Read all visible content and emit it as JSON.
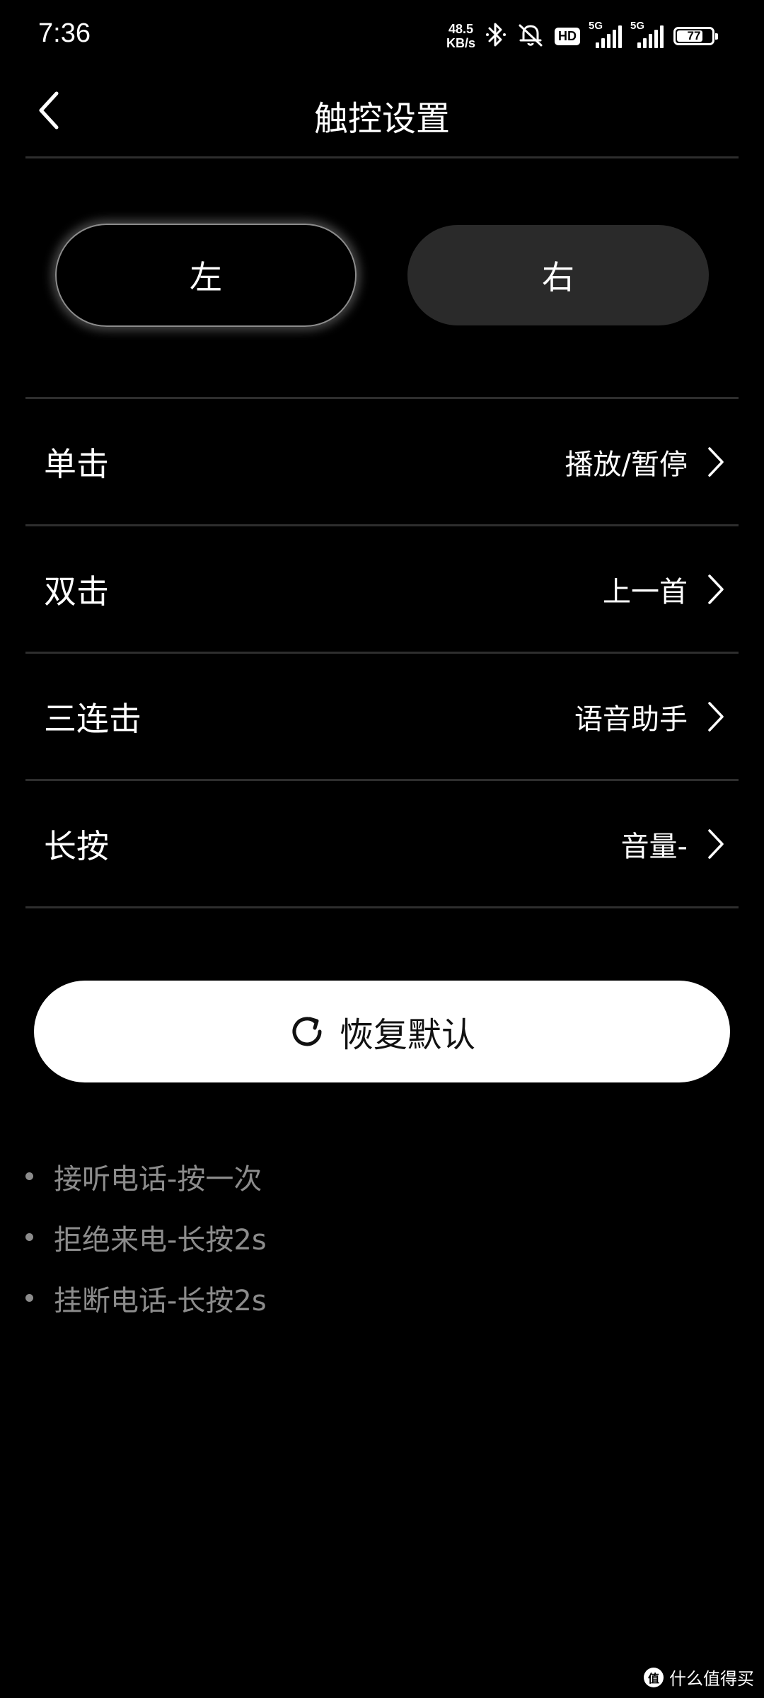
{
  "status_bar": {
    "time": "7:36",
    "net_speed_value": "48.5",
    "net_speed_unit": "KB/s",
    "hd_label": "HD",
    "signal_1_label": "5G",
    "signal_2_label": "5G",
    "battery_percent": "77",
    "battery_level": 0.77,
    "icons": [
      "bluetooth-icon",
      "mute-bell-icon"
    ]
  },
  "header": {
    "title": "触控设置",
    "back_icon": "chevron-left-icon"
  },
  "side_toggle": {
    "left_label": "左",
    "right_label": "右",
    "selected": "left"
  },
  "gestures": [
    {
      "label": "单击",
      "value": "播放/暂停"
    },
    {
      "label": "双击",
      "value": "上一首"
    },
    {
      "label": "三连击",
      "value": "语音助手"
    },
    {
      "label": "长按",
      "value": "音量-"
    }
  ],
  "reset": {
    "label": "恢复默认",
    "icon": "refresh-icon"
  },
  "notes": [
    "接听电话-按一次",
    "拒绝来电-长按2s",
    "挂断电话-长按2s"
  ],
  "watermark": {
    "logo_text": "值",
    "text": "什么值得买"
  },
  "colors": {
    "background": "#000000",
    "divider": "#2e2e2e",
    "inactive_toggle": "#2a2a2a",
    "reset_button": "#ffffff",
    "note_text": "#8c8c8c"
  }
}
